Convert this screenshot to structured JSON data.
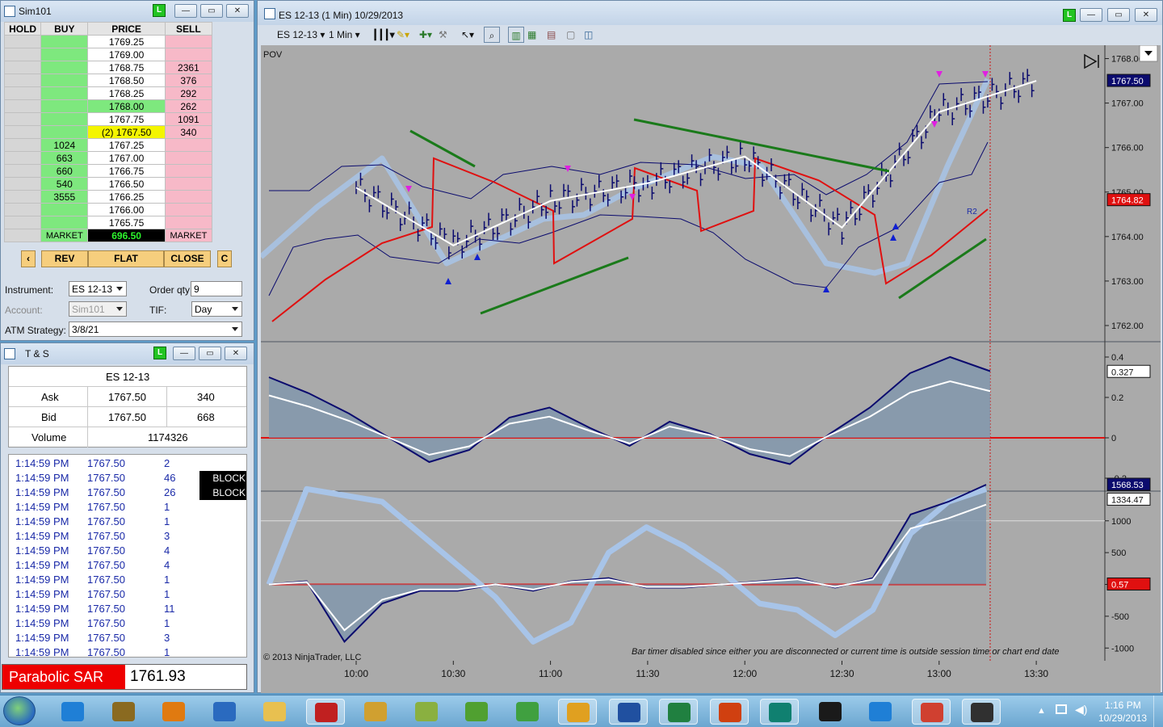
{
  "dom": {
    "title": "Sim101",
    "hdr": {
      "hold": "HOLD",
      "buy": "BUY",
      "price": "PRICE",
      "sell": "SELL"
    },
    "rows": [
      {
        "buy": "",
        "price": "1769.25",
        "sell": ""
      },
      {
        "buy": "",
        "price": "1769.00",
        "sell": ""
      },
      {
        "buy": "",
        "price": "1768.75",
        "sell": "2361"
      },
      {
        "buy": "",
        "price": "1768.50",
        "sell": "376"
      },
      {
        "buy": "",
        "price": "1768.25",
        "sell": "292"
      },
      {
        "buy": "",
        "price": "1768.00",
        "sell": "262"
      },
      {
        "buy": "",
        "price": "1767.75",
        "sell": "1091"
      },
      {
        "buy": "",
        "price": "(2) 1767.50",
        "sell": "340"
      },
      {
        "buy": "1024",
        "price": "1767.25",
        "sell": ""
      },
      {
        "buy": "663",
        "price": "1767.00",
        "sell": ""
      },
      {
        "buy": "660",
        "price": "1766.75",
        "sell": ""
      },
      {
        "buy": "540",
        "price": "1766.50",
        "sell": ""
      },
      {
        "buy": "3555",
        "price": "1766.25",
        "sell": ""
      },
      {
        "buy": "",
        "price": "1766.00",
        "sell": ""
      },
      {
        "buy": "",
        "price": "1765.75",
        "sell": ""
      }
    ],
    "market_buy": "MARKET",
    "pnl": "696.50",
    "market_sell": "MARKET",
    "btn_left": "‹",
    "rev": "REV",
    "flat": "FLAT",
    "close": "CLOSE",
    "btn_c": "C",
    "instrument_lbl": "Instrument:",
    "instrument": "ES 12-13",
    "qty_lbl": "Order qty:",
    "qty": "9",
    "account_lbl": "Account:",
    "account": "Sim101",
    "tif_lbl": "TIF:",
    "tif": "Day",
    "atm_lbl": "ATM Strategy:",
    "atm": "3/8/21"
  },
  "ts": {
    "title": "T & S",
    "instrument": "ES 12-13",
    "ask_lbl": "Ask",
    "ask": "1767.50",
    "ask_size": "340",
    "bid_lbl": "Bid",
    "bid": "1767.50",
    "bid_size": "668",
    "vol_lbl": "Volume",
    "vol": "1174326",
    "trades": [
      {
        "time": "1:14:59 PM",
        "price": "1767.50",
        "size": "2",
        "tag": ""
      },
      {
        "time": "1:14:59 PM",
        "price": "1767.50",
        "size": "46",
        "tag": "BLOCK"
      },
      {
        "time": "1:14:59 PM",
        "price": "1767.50",
        "size": "26",
        "tag": "BLOCK"
      },
      {
        "time": "1:14:59 PM",
        "price": "1767.50",
        "size": "1",
        "tag": ""
      },
      {
        "time": "1:14:59 PM",
        "price": "1767.50",
        "size": "1",
        "tag": ""
      },
      {
        "time": "1:14:59 PM",
        "price": "1767.50",
        "size": "3",
        "tag": ""
      },
      {
        "time": "1:14:59 PM",
        "price": "1767.50",
        "size": "4",
        "tag": ""
      },
      {
        "time": "1:14:59 PM",
        "price": "1767.50",
        "size": "4",
        "tag": ""
      },
      {
        "time": "1:14:59 PM",
        "price": "1767.50",
        "size": "1",
        "tag": ""
      },
      {
        "time": "1:14:59 PM",
        "price": "1767.50",
        "size": "1",
        "tag": ""
      },
      {
        "time": "1:14:59 PM",
        "price": "1767.50",
        "size": "11",
        "tag": ""
      },
      {
        "time": "1:14:59 PM",
        "price": "1767.50",
        "size": "1",
        "tag": ""
      },
      {
        "time": "1:14:59 PM",
        "price": "1767.50",
        "size": "3",
        "tag": ""
      },
      {
        "time": "1:14:59 PM",
        "price": "1767.50",
        "size": "1",
        "tag": ""
      }
    ],
    "sar_lbl": "Parabolic SAR",
    "sar": "1761.93"
  },
  "chart": {
    "title": "ES 12-13 (1 Min)  10/29/2013",
    "tb_instrument": "ES 12-13",
    "tb_interval": "1 Min",
    "pov": "POV",
    "copyright": "© 2013 NinjaTrader, LLC",
    "bar_timer": "Bar timer disabled since either you are disconnected or current time is outside session time or chart end date",
    "r2": "R2",
    "price_ticks": [
      "1768.00",
      "1767.00",
      "1766.00",
      "1765.00",
      "1764.00",
      "1763.00",
      "1762.00"
    ],
    "last_price": "1767.50",
    "sar_price": "1764.82",
    "osc_ticks": [
      "0.4",
      "0.2",
      "0",
      "-0.2"
    ],
    "osc_value": "0.327",
    "vol_ticks": [
      "1000",
      "500",
      "0",
      "-500",
      "-1000"
    ],
    "vol_value1": "1568.53",
    "vol_value2": "1334.47",
    "vol_value3": "0.57",
    "time_ticks": [
      "10:00",
      "10:30",
      "11:00",
      "11:30",
      "12:00",
      "12:30",
      "13:00",
      "13:30"
    ]
  },
  "taskbar": {
    "time": "1:16 PM",
    "date": "10/29/2013"
  },
  "colors": {
    "up": "#0b0b6e",
    "sar": "#e01010",
    "arrow": "#1a7a1a",
    "band": "#a8c4e8",
    "panel": "#aaaaaa"
  },
  "chart_data": {
    "type": "line",
    "title": "ES 12-13 (1 Min)  10/29/2013",
    "x": [
      "10:00",
      "10:30",
      "11:00",
      "11:30",
      "12:00",
      "12:30",
      "13:00",
      "13:30"
    ],
    "series": [
      {
        "values": [
          1765.1,
          1763.8,
          1764.8,
          1765.2,
          1765.8,
          1764.2,
          1766.8,
          1767.5
        ]
      }
    ],
    "ylim": [
      1761.8,
      1768.3
    ],
    "grid": false
  }
}
